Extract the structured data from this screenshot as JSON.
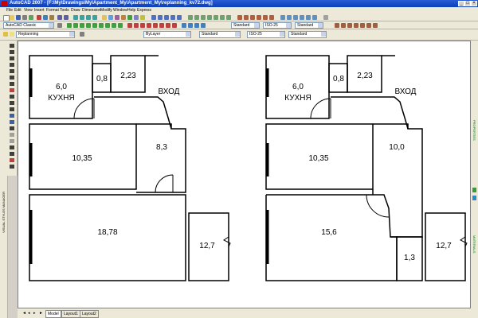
{
  "window": {
    "title": "AutoCAD 2007 - [F:\\My\\Drawings\\My\\Apartment_My\\Apartment_My\\replanning_kv72.dwg]",
    "minimize": "_",
    "maximize": "□",
    "close": "×"
  },
  "menu": [
    "File",
    "Edit",
    "View",
    "Insert",
    "Format",
    "Tools",
    "Draw",
    "Dimension",
    "Modify",
    "Window",
    "Help",
    "Express"
  ],
  "toolbar": {
    "workspace": "AutoCAD Classic",
    "layer": "Replanning",
    "text_style": "Standard",
    "dim_style": "ISO-25",
    "table_style": "Standard",
    "layer2": "ByLayer",
    "dim_style2": "ISO-25",
    "plot_style": "Standard"
  },
  "side_labels": {
    "left": "VISUAL STYLES MANAGER",
    "right_top": "PROPERTIES",
    "right_bottom": "MATERIALS"
  },
  "plans": [
    {
      "rooms": [
        {
          "label": "6,0",
          "sub": "КУХНЯ"
        },
        {
          "label": "0,8"
        },
        {
          "label": "2,23"
        },
        {
          "label": "ВХОД"
        },
        {
          "label": "10,35"
        },
        {
          "label": "8,3"
        },
        {
          "label": "18,78"
        },
        {
          "label": "12,7"
        }
      ]
    },
    {
      "rooms": [
        {
          "label": "6,0",
          "sub": "КУХНЯ"
        },
        {
          "label": "0,8"
        },
        {
          "label": "2,23"
        },
        {
          "label": "ВХОД"
        },
        {
          "label": "10,35"
        },
        {
          "label": "10,0"
        },
        {
          "label": "15,6"
        },
        {
          "label": "1,3"
        },
        {
          "label": "12,7"
        }
      ]
    }
  ],
  "tabs": [
    "Model",
    "Layout1",
    "Layout2"
  ],
  "colors": {
    "title_bar": "#0a3fb8",
    "canvas": "#ffffff",
    "walls": "#000000"
  }
}
